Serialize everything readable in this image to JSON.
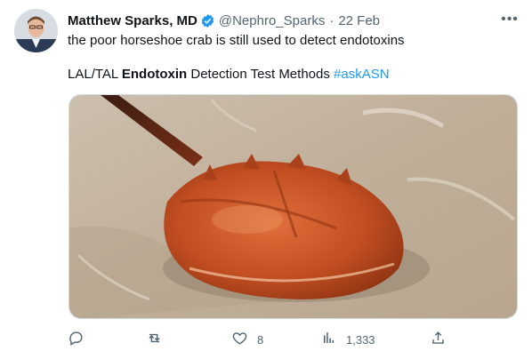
{
  "tweet": {
    "author_name": "Matthew Sparks, MD",
    "handle": "@Nephro_Sparks",
    "separator": "·",
    "date": "22 Feb",
    "text_line1": "the poor horseshoe crab is still used to detect endotoxins",
    "text_line2_part1": "LAL/TAL ",
    "text_line2_bold": "Endotoxin",
    "text_line2_part2": " Detection Test Methods ",
    "hashtag": "#askASN"
  },
  "actions": {
    "reply_count": "",
    "retweet_count": "",
    "like_count": "8",
    "views_count": "1,333"
  },
  "icons": [
    "verified-badge-icon",
    "more-icon",
    "reply-icon",
    "retweet-icon",
    "like-icon",
    "views-icon",
    "share-icon"
  ],
  "colors": {
    "accent": "#1d9bf0",
    "muted": "#536471",
    "text": "#0f1419"
  }
}
